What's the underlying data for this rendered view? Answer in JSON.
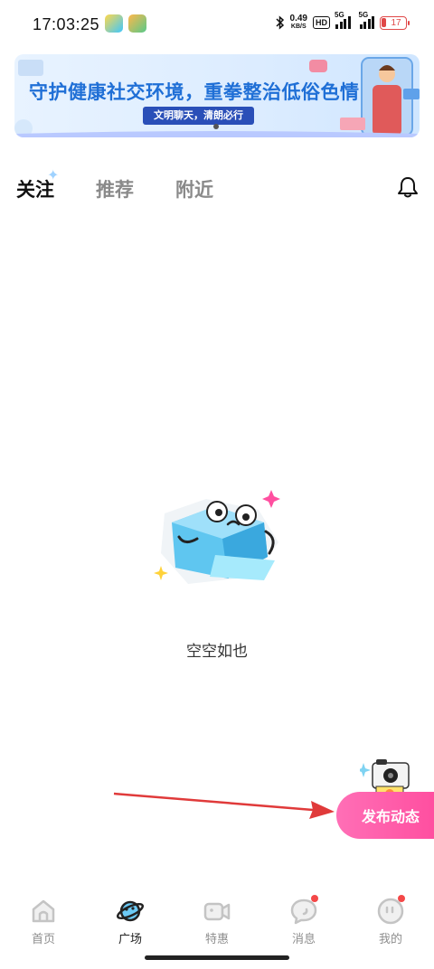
{
  "status_bar": {
    "time": "17:03:25",
    "net_speed_value": "0.49",
    "net_speed_unit": "KB/S",
    "hd_label": "HD",
    "signal_1_label": "5G",
    "signal_2_label": "5G",
    "battery_level": "17",
    "battery_color": "#e04848"
  },
  "banner": {
    "title": "守护健康社交环境，重拳整治低俗色情",
    "tag": "文明聊天，清朗必行",
    "title_color": "#1f6fd6"
  },
  "tabs": [
    {
      "label": "关注",
      "active": true
    },
    {
      "label": "推荐",
      "active": false
    },
    {
      "label": "附近",
      "active": false
    }
  ],
  "header": {
    "bell_icon": "bell-icon"
  },
  "empty_state": {
    "text": "空空如也",
    "illustration": "ice-cube-mascot"
  },
  "publish": {
    "label": "发布动态",
    "color": "#ff4fa0",
    "icon": "camera-icon"
  },
  "bottom_nav": [
    {
      "label": "首页",
      "icon": "home-icon",
      "active": false,
      "badge": false
    },
    {
      "label": "广场",
      "icon": "planet-icon",
      "active": true,
      "badge": false
    },
    {
      "label": "特惠",
      "icon": "video-camera-icon",
      "active": false,
      "badge": false
    },
    {
      "label": "消息",
      "icon": "message-icon",
      "active": false,
      "badge": true
    },
    {
      "label": "我的",
      "icon": "profile-icon",
      "active": false,
      "badge": true
    }
  ],
  "colors": {
    "accent": "#ff4fa0",
    "badge": "#f44848",
    "annotation_arrow": "#e03a3a"
  }
}
